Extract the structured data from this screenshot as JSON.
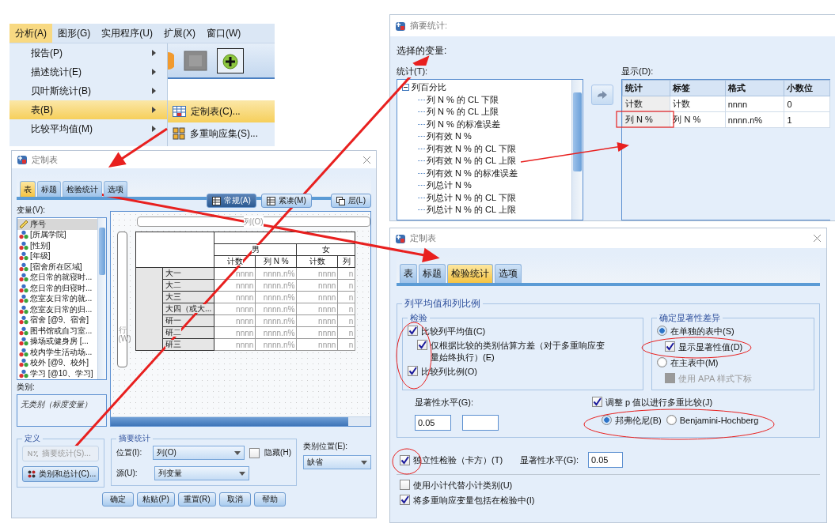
{
  "menu": {
    "bar": [
      {
        "label": "分析(A)",
        "selected": true
      },
      {
        "label": "图形(G)",
        "selected": false
      },
      {
        "label": "实用程序(U)",
        "selected": false
      },
      {
        "label": "扩展(X)",
        "selected": false
      },
      {
        "label": "窗口(W)",
        "selected": false
      }
    ],
    "items": [
      {
        "label": "报告(P)",
        "selected": false
      },
      {
        "label": "描述统计(E)",
        "selected": false
      },
      {
        "label": "贝叶斯统计(B)",
        "selected": false
      },
      {
        "label": "表(B)",
        "selected": true
      },
      {
        "label": "比较平均值(M)",
        "selected": false
      }
    ],
    "submenu": [
      {
        "label": "定制表(C)...",
        "selected": true,
        "kind": "table"
      },
      {
        "label": "多重响应集(S)...",
        "selected": false,
        "kind": "sets"
      }
    ]
  },
  "custom_tables": {
    "title": "定制表",
    "tabs": [
      {
        "label": "表",
        "selected": true
      },
      {
        "label": "标题",
        "selected": false
      },
      {
        "label": "检验统计",
        "selected": false
      },
      {
        "label": "选项",
        "selected": false
      }
    ],
    "variables_label": "变量(V):",
    "variables": [
      {
        "name": "序号",
        "kind": "scale",
        "selected": true
      },
      {
        "name": "[所属学院]",
        "kind": "nominal",
        "selected": false
      },
      {
        "name": "[性别]",
        "kind": "nominal",
        "selected": false
      },
      {
        "name": "[年级]",
        "kind": "nominal",
        "selected": false
      },
      {
        "name": "[宿舍所在区域]",
        "kind": "nominal",
        "selected": false
      },
      {
        "name": "您日常的就寝时...",
        "kind": "nominal",
        "selected": false
      },
      {
        "name": "您日常的归寝时...",
        "kind": "nominal",
        "selected": false
      },
      {
        "name": "您室友日常的就...",
        "kind": "nominal",
        "selected": false
      },
      {
        "name": "您室友日常的归...",
        "kind": "nominal",
        "selected": false
      },
      {
        "name": "宿舍 [@9、宿舍]",
        "kind": "nominal",
        "selected": false
      },
      {
        "name": "图书馆或自习室...",
        "kind": "nominal",
        "selected": false
      },
      {
        "name": "操场或健身房 [...",
        "kind": "nominal",
        "selected": false
      },
      {
        "name": "校内学生活动场...",
        "kind": "nominal",
        "selected": false
      },
      {
        "name": "校外 [@9、校外]",
        "kind": "nominal",
        "selected": false
      },
      {
        "name": "学习 [@10、学习]",
        "kind": "nominal",
        "selected": false
      }
    ],
    "categories_label": "类别:",
    "categories_text": "无类别（标度变量）",
    "view_buttons": [
      {
        "label": "常规(A)",
        "selected": true
      },
      {
        "label": "紧凑(M)",
        "selected": false
      },
      {
        "label": "层(L)",
        "selected": false
      }
    ],
    "canvas": {
      "column_label": "列(O)",
      "row_label": "行(W)",
      "groups": [
        "男",
        "女"
      ],
      "stats": [
        "计数",
        "列 N %",
        "计数",
        "列"
      ],
      "rows": [
        {
          "label": "大一",
          "cells": [
            "nnnn",
            "nnnn.n%",
            "nnnn",
            "n"
          ]
        },
        {
          "label": "大二",
          "cells": [
            "nnnn",
            "nnnn.n%",
            "nnnn",
            "n"
          ]
        },
        {
          "label": "大三",
          "cells": [
            "nnnn",
            "nnnn.n%",
            "nnnn",
            "n"
          ]
        },
        {
          "label": "大四（或大...",
          "cells": [
            "nnnn",
            "nnnn.n%",
            "nnnn",
            "n"
          ]
        },
        {
          "label": "研一",
          "cells": [
            "nnnn",
            "nnnn.n%",
            "nnnn",
            "n"
          ]
        },
        {
          "label": "研二",
          "cells": [
            "nnnn",
            "nnnn.n%",
            "nnnn",
            "n"
          ]
        },
        {
          "label": "研三",
          "cells": [
            "nnnn",
            "nnnn.n%",
            "nnnn",
            "n"
          ]
        }
      ]
    },
    "define": {
      "title": "定义",
      "buttons": [
        {
          "label": "摘要统计(S)...",
          "kind": "stats",
          "disabled": true
        },
        {
          "label": "类别和总计(C)...",
          "kind": "categories",
          "disabled": false
        }
      ]
    },
    "summary": {
      "title": "摘要统计",
      "position_label": "位置(I):",
      "position_value": "列(O)",
      "hide_label": "隐藏(H)",
      "hide_checked": false,
      "source_label": "源(U):",
      "source_value": "列变量"
    },
    "category_position": {
      "label": "类别位置(E):",
      "value": "缺省"
    },
    "buttons": [
      "确定",
      "粘贴(P)",
      "重置(R)",
      "取消",
      "帮助"
    ]
  },
  "summary_statistics": {
    "title": "摘要统计:",
    "selected_label": "选择的变量:",
    "stats_label": "统计(T):",
    "tree": {
      "label": "列百分比",
      "expanded": true,
      "children": [
        {
          "label": "列 N % 的 CL 下限"
        },
        {
          "label": "列 N % 的 CL 上限"
        },
        {
          "label": "列 N % 的标准误差"
        },
        {
          "label": "列有效 N %"
        },
        {
          "label": "列有效 N % 的 CL 下限"
        },
        {
          "label": "列有效 N % 的 CL 上限"
        },
        {
          "label": "列有效 N % 的标准误差"
        },
        {
          "label": "列总计 N %"
        },
        {
          "label": "列总计 N % 的 CL 下限"
        },
        {
          "label": "列总计 N % 的 CL 上限"
        }
      ]
    },
    "display_label": "显示(D):",
    "columns": [
      "统计",
      "标签",
      "格式",
      "小数位"
    ],
    "rows": [
      [
        "计数",
        "计数",
        "nnnn",
        "0"
      ],
      [
        "列 N %",
        "列 N %",
        "nnnn.n%",
        "1"
      ]
    ]
  },
  "test_statistics": {
    "title": "定制表",
    "tabs": [
      {
        "label": "表",
        "selected": false
      },
      {
        "label": "标题",
        "selected": false
      },
      {
        "label": "检验统计",
        "selected": true
      },
      {
        "label": "选项",
        "selected": false
      }
    ],
    "group_title": "列平均值和列比例",
    "tests": {
      "title": "检验",
      "options": [
        {
          "label": "比较列平均值(C)",
          "checked": true,
          "children": [
            {
              "label": "仅根据比较的类别估算方差（对于多重响应变量始终执行）(E)",
              "checked": true
            }
          ]
        },
        {
          "label": "比较列比例(O)",
          "checked": true
        }
      ]
    },
    "significance": {
      "title": "确定显著性差异",
      "options": [
        {
          "label": "在单独的表中(S)",
          "selected": true,
          "children": [
            {
              "label": "显示显著性值(D)",
              "checked": true,
              "disabled": false
            }
          ]
        },
        {
          "label": "在主表中(M)",
          "selected": false,
          "children": [
            {
              "label": "使用 APA 样式下标",
              "checked": false,
              "disabled": true
            }
          ]
        }
      ]
    },
    "level_label": "显著性水平(G):",
    "level_value": "0.05",
    "adjust": {
      "label": "调整 p 值以进行多重比较(J)",
      "checked": true,
      "methods": [
        {
          "label": "邦弗伦尼(B)",
          "selected": true
        },
        {
          "label": "Benjamini-Hochberg",
          "selected": false
        }
      ]
    },
    "chi_square": {
      "label": "独立性检验（卡方）(T)",
      "checked": true,
      "level_label": "显著性水平(G):",
      "level_value": "0.05"
    },
    "options": [
      {
        "label": "使用小计代替小计类别(U)",
        "checked": false
      },
      {
        "label": "将多重响应变量包括在检验中(I)",
        "checked": true
      }
    ]
  }
}
